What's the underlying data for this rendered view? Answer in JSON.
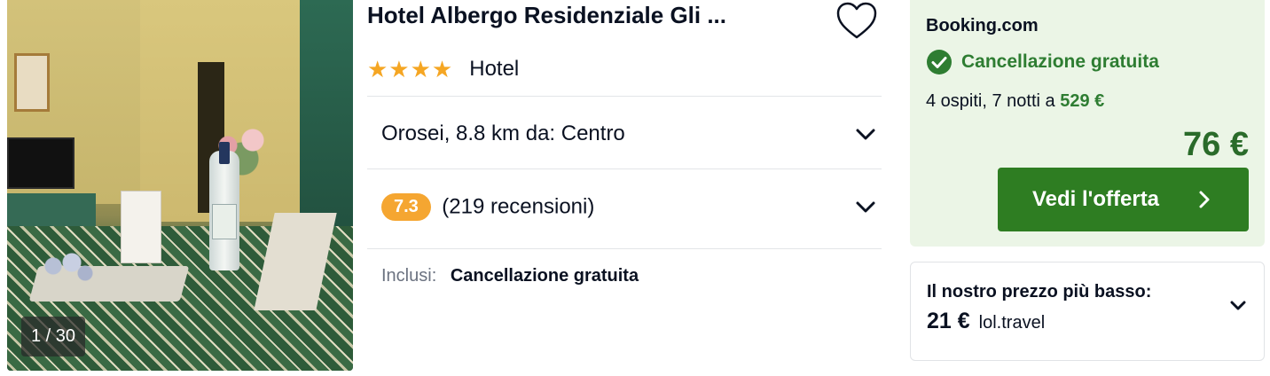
{
  "photo": {
    "counter": "1 / 30"
  },
  "hotel": {
    "name": "Hotel Albergo Residenziale Gli ...",
    "stars": "★★★★",
    "type": "Hotel",
    "location": "Orosei, 8.8 km da: Centro",
    "rating": "7.3",
    "reviews": "(219 recensioni)",
    "included_label": "Inclusi:",
    "included_value": "Cancellazione gratuita"
  },
  "deal": {
    "provider": "Booking.com",
    "cancellation": "Cancellazione gratuita",
    "guests_nights": "4 ospiti, 7 notti a",
    "total": "529 €",
    "price": "76 €",
    "cta_label": "Vedi l'offerta"
  },
  "lowest": {
    "title": "Il nostro prezzo più basso:",
    "price": "21 €",
    "site": "lol.travel"
  },
  "colors": {
    "accent_green": "#2e7d22",
    "rating_orange": "#f5a631",
    "star_orange": "#f5a623",
    "deal_bg": "#ebf5e6"
  }
}
